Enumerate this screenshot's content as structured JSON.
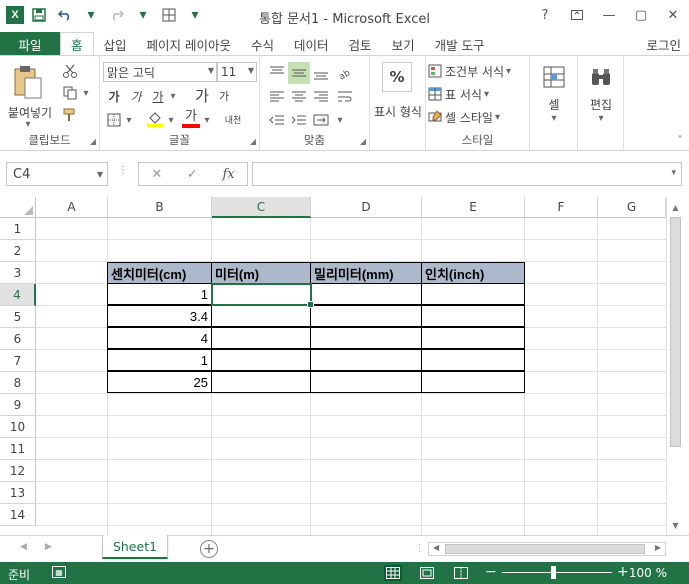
{
  "window": {
    "title": "통합 문서1 - Microsoft Excel",
    "help": "?",
    "minimize": "—",
    "restore": "▢",
    "close": "✕"
  },
  "qat": {
    "logo": "X",
    "save_icon": "save-icon",
    "undo_icon": "undo-icon",
    "redo_icon": "redo-icon",
    "customize_icon": "table-icon"
  },
  "ribbon_tabs": {
    "file": "파일",
    "items": [
      "홈",
      "삽입",
      "페이지 레이아웃",
      "수식",
      "데이터",
      "검토",
      "보기",
      "개발 도구"
    ],
    "active": "홈",
    "signin": "로그인"
  },
  "ribbon": {
    "clipboard": {
      "paste": "붙여넣기",
      "label": "클립보드"
    },
    "font": {
      "font_name": "맑은 고딕",
      "font_size": "11",
      "bold": "가",
      "italic": "가",
      "underline": "가",
      "grow": "가",
      "shrink": "가",
      "font_color_glyph": "가",
      "phonetic": "내천",
      "label": "글꼴",
      "font_color": "#ff0000",
      "fill_color": "#ffff00"
    },
    "alignment": {
      "label": "맞춤"
    },
    "number": {
      "label": "표시 형식",
      "percent": "%"
    },
    "styles": {
      "conditional": "조건부 서식",
      "table": "표 서식",
      "cell_styles": "셀 스타일",
      "label": "스타일"
    },
    "cells": {
      "label": "셀"
    },
    "editing": {
      "label": "편집"
    }
  },
  "formula_bar": {
    "name_box": "C4",
    "fx": "fx",
    "formula": ""
  },
  "grid": {
    "columns": [
      "A",
      "B",
      "C",
      "D",
      "E",
      "F",
      "G"
    ],
    "selected_column": "C",
    "rows": [
      "1",
      "2",
      "3",
      "4",
      "5",
      "6",
      "7",
      "8",
      "9",
      "10",
      "11",
      "12",
      "13",
      "14"
    ],
    "selected_row": "4",
    "selected_cell": "C4",
    "headers": [
      "센치미터(cm)",
      "미터(m)",
      "밀리미터(mm)",
      "인치(inch)"
    ],
    "header_fill": "#acb9ca",
    "centimeters": [
      "1",
      "3.4",
      "4",
      "1",
      "25"
    ]
  },
  "sheet_tabs": {
    "active": "Sheet1",
    "add": "+"
  },
  "status_bar": {
    "ready": "준비",
    "zoom": "100 %",
    "accent": "#217346"
  }
}
